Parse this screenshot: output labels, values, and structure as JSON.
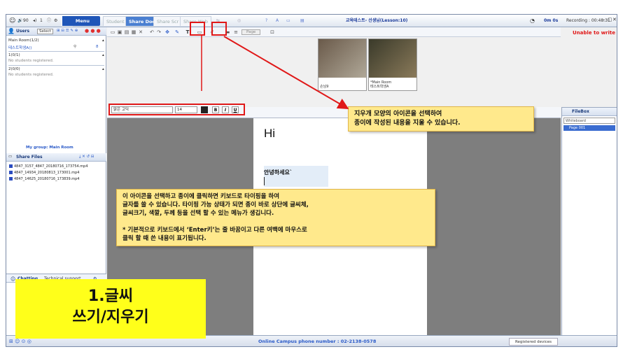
{
  "titlebar": {
    "speaker_count": "90",
    "mic_count": "1",
    "menu_label": "Menu",
    "tabs": [
      {
        "label": "Student",
        "active": false
      },
      {
        "label": "Share Docs",
        "active": true
      },
      {
        "label": "Share Scr",
        "active": false
      },
      {
        "label": "Share Web",
        "active": false
      }
    ],
    "window_title": "교육테스트- 선생님(Lesson:10)",
    "timer": "0m 0s",
    "recording": "Recording : 00:48:31"
  },
  "users_panel": {
    "title": "Users",
    "select_label": "Select",
    "main_room": "Main Room(1/2)",
    "current_user": "테스트학생A()",
    "current_user_value": "8",
    "room1": "1(0/1)",
    "room1_note": "No students registered.",
    "room2": "2(0/0)",
    "room2_note": "No students registered.",
    "group_label": "My group: Main Room"
  },
  "share_files": {
    "title": "Share Files",
    "files": [
      "4847_3157_4847_20180716_173754.mp4",
      "4847_14934_20180813_173001.mp4",
      "4847_14625_20180716_173839.mp4"
    ]
  },
  "chat": {
    "tab_chatting": "Chatting",
    "tab_support": "Technical support"
  },
  "toolbar": {
    "page_label": "Page"
  },
  "videos": [
    {
      "label": "손님9",
      "colors": [
        "#6a5a4a",
        "#b0a898"
      ]
    },
    {
      "label": "*Main Room\n테스트학생A",
      "colors": [
        "#3a3a2a",
        "#8a7a5a"
      ]
    }
  ],
  "format_bar": {
    "font": "맑은 고딕",
    "size": "14",
    "bold": "B",
    "italic": "I",
    "underline": "U"
  },
  "paper": {
    "hi_text": "Hi",
    "greeting": "안녕하세요`"
  },
  "right_panel": {
    "warning": "Unable to write",
    "filebox_title": "FileBox",
    "filebox_select": "Whiteboard",
    "filebox_item": "Page 001"
  },
  "statusbar": {
    "phone": "Online Campus phone number : 02-2138-0578",
    "registered": "Registered devices"
  },
  "annotations": {
    "eraser_note": "지우개 모양의 아이콘을 선택하여\n종이에 작성된 내용을 지울 수 있습니다.",
    "text_note": "이 아이콘을 선택하고 종이에 클릭하면 키보드로 타이핑을 하여\n글자를 쓸 수 있습니다. 타이핑 가능 상태가 되면 종이 바로 상단에  글씨체,\n글씨크기, 색깔, 두께 등을 선택 할 수 있는 메뉴가 생깁니다.\n\n* 기본적으로 키보드에서 ‘Enter키’는 줄 바꿈이고 다른 여백에 마우스로\n클릭 할 때 쓴 내용이 표기됩니다.",
    "big_label_line1": "1.글씨",
    "big_label_line2": "쓰기/지우기"
  },
  "colors": {
    "accent": "#1f56b8",
    "highlight": "#e01818",
    "callout": "#ffe98c",
    "label_bg": "#ffff1a"
  }
}
